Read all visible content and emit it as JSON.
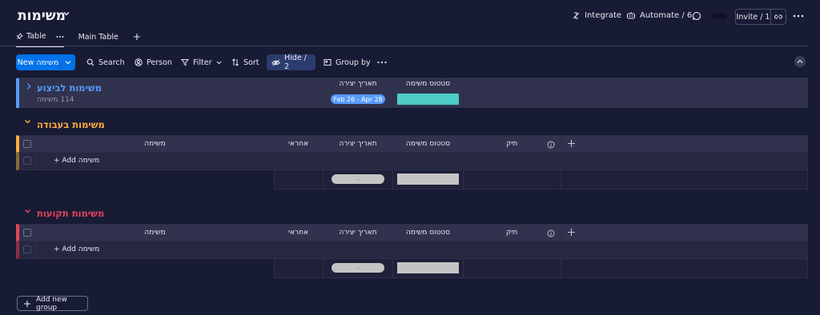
{
  "board": {
    "title": "משימות"
  },
  "topbar": {
    "integrate_label": "Integrate",
    "automate_label": "Automate / 6",
    "invite_label": "Invite / 1"
  },
  "tabs": [
    {
      "label": "Table",
      "active": true
    },
    {
      "label": "Main Table",
      "active": false
    }
  ],
  "toolbar": {
    "new_item_label": "New משימה",
    "search_label": "Search",
    "person_label": "Person",
    "filter_label": "Filter",
    "sort_label": "Sort",
    "hide_label": "Hide / 2",
    "group_by_label": "Group by"
  },
  "columns": {
    "item": "משימה",
    "owner": "אחראי",
    "created": "תאריך יצירה",
    "status": "סטטוס משימה",
    "tag": "תיק"
  },
  "groups": [
    {
      "title": "משימות לביצוע",
      "count_label": "114 משימה",
      "color": "#579bfc",
      "collapsed": true,
      "date_range": "Feb 26 - Apr 28",
      "date_pill_color": "#579bfc",
      "status_bar_color": "#4eccc6"
    },
    {
      "title": "משימות בעבודה",
      "color": "#fdab3d",
      "collapsed": false,
      "add_item_label": "+ Add משימה"
    },
    {
      "title": "משימות תקועות",
      "color": "#e2445c",
      "collapsed": false,
      "add_item_label": "+ Add משימה"
    }
  ],
  "add_group_label": "Add new group",
  "colors": {
    "background": "#181b34",
    "accent": "#0073ea",
    "empty_summary": "#c4c4c4"
  }
}
